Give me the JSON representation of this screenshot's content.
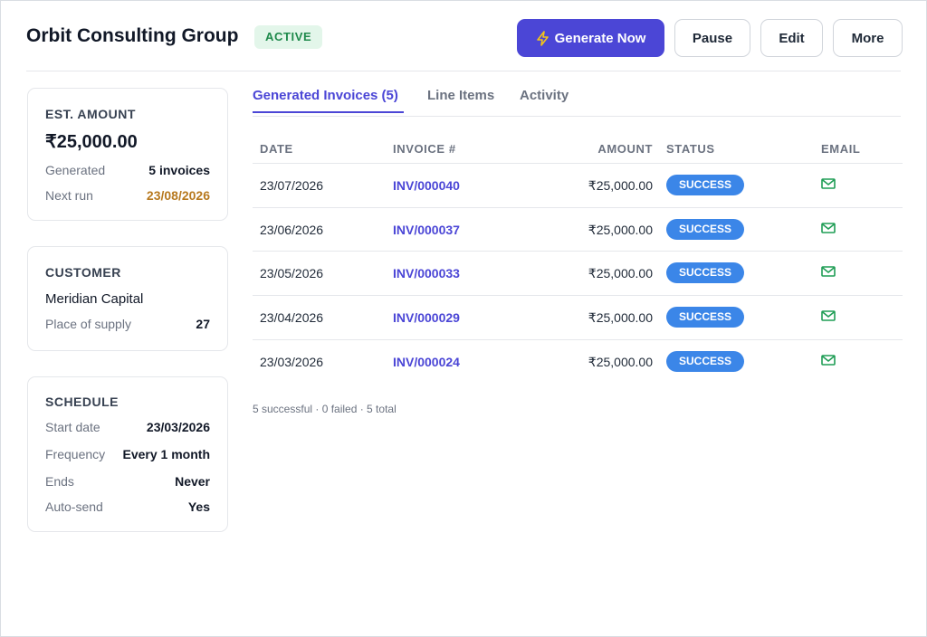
{
  "header": {
    "title": "Orbit Consulting Group",
    "status": "ACTIVE",
    "buttons": {
      "generate": "Generate Now",
      "pause": "Pause",
      "edit": "Edit",
      "more": "More"
    }
  },
  "summary": {
    "label": "EST. AMOUNT",
    "amount": "₹25,000.00",
    "generated_label": "Generated",
    "generated_value": "5 invoices",
    "next_run_label": "Next run",
    "next_run_value": "23/08/2026"
  },
  "customer": {
    "label": "CUSTOMER",
    "name": "Meridian Capital",
    "supply_label": "Place of supply",
    "supply_value": "27"
  },
  "schedule": {
    "label": "SCHEDULE",
    "rows": [
      {
        "key": "Start date",
        "value": "23/03/2026"
      },
      {
        "key": "Frequency",
        "value": "Every 1 month"
      },
      {
        "key": "Ends",
        "value": "Never"
      },
      {
        "key": "Auto-send",
        "value": "Yes"
      }
    ]
  },
  "tabs": [
    {
      "label": "Generated Invoices (5)",
      "active": true
    },
    {
      "label": "Line Items",
      "active": false
    },
    {
      "label": "Activity",
      "active": false
    }
  ],
  "table": {
    "columns": {
      "date": "DATE",
      "invoice": "INVOICE #",
      "amount": "AMOUNT",
      "status": "STATUS",
      "email": "EMAIL"
    },
    "rows": [
      {
        "date": "23/07/2026",
        "invoice": "INV/000040",
        "amount": "₹25,000.00",
        "status": "SUCCESS",
        "email_icon": "mail-icon"
      },
      {
        "date": "23/06/2026",
        "invoice": "INV/000037",
        "amount": "₹25,000.00",
        "status": "SUCCESS",
        "email_icon": "mail-icon"
      },
      {
        "date": "23/05/2026",
        "invoice": "INV/000033",
        "amount": "₹25,000.00",
        "status": "SUCCESS",
        "email_icon": "mail-icon"
      },
      {
        "date": "23/04/2026",
        "invoice": "INV/000029",
        "amount": "₹25,000.00",
        "status": "SUCCESS",
        "email_icon": "mail-icon"
      },
      {
        "date": "23/03/2026",
        "invoice": "INV/000024",
        "amount": "₹25,000.00",
        "status": "SUCCESS",
        "email_icon": "mail-icon"
      }
    ],
    "footer": "5 successful · 0 failed · 5 total"
  },
  "colors": {
    "accent": "#4b46d6",
    "active_badge_bg": "#e3f6ea",
    "active_badge_text": "#1f8a4c",
    "status_success": "#3b86e8",
    "next_run": "#b7791f",
    "mail_icon": "#1f9d55"
  },
  "icons": {
    "generate_button": "lightning-bolt-icon",
    "email_column": "mail-icon"
  }
}
